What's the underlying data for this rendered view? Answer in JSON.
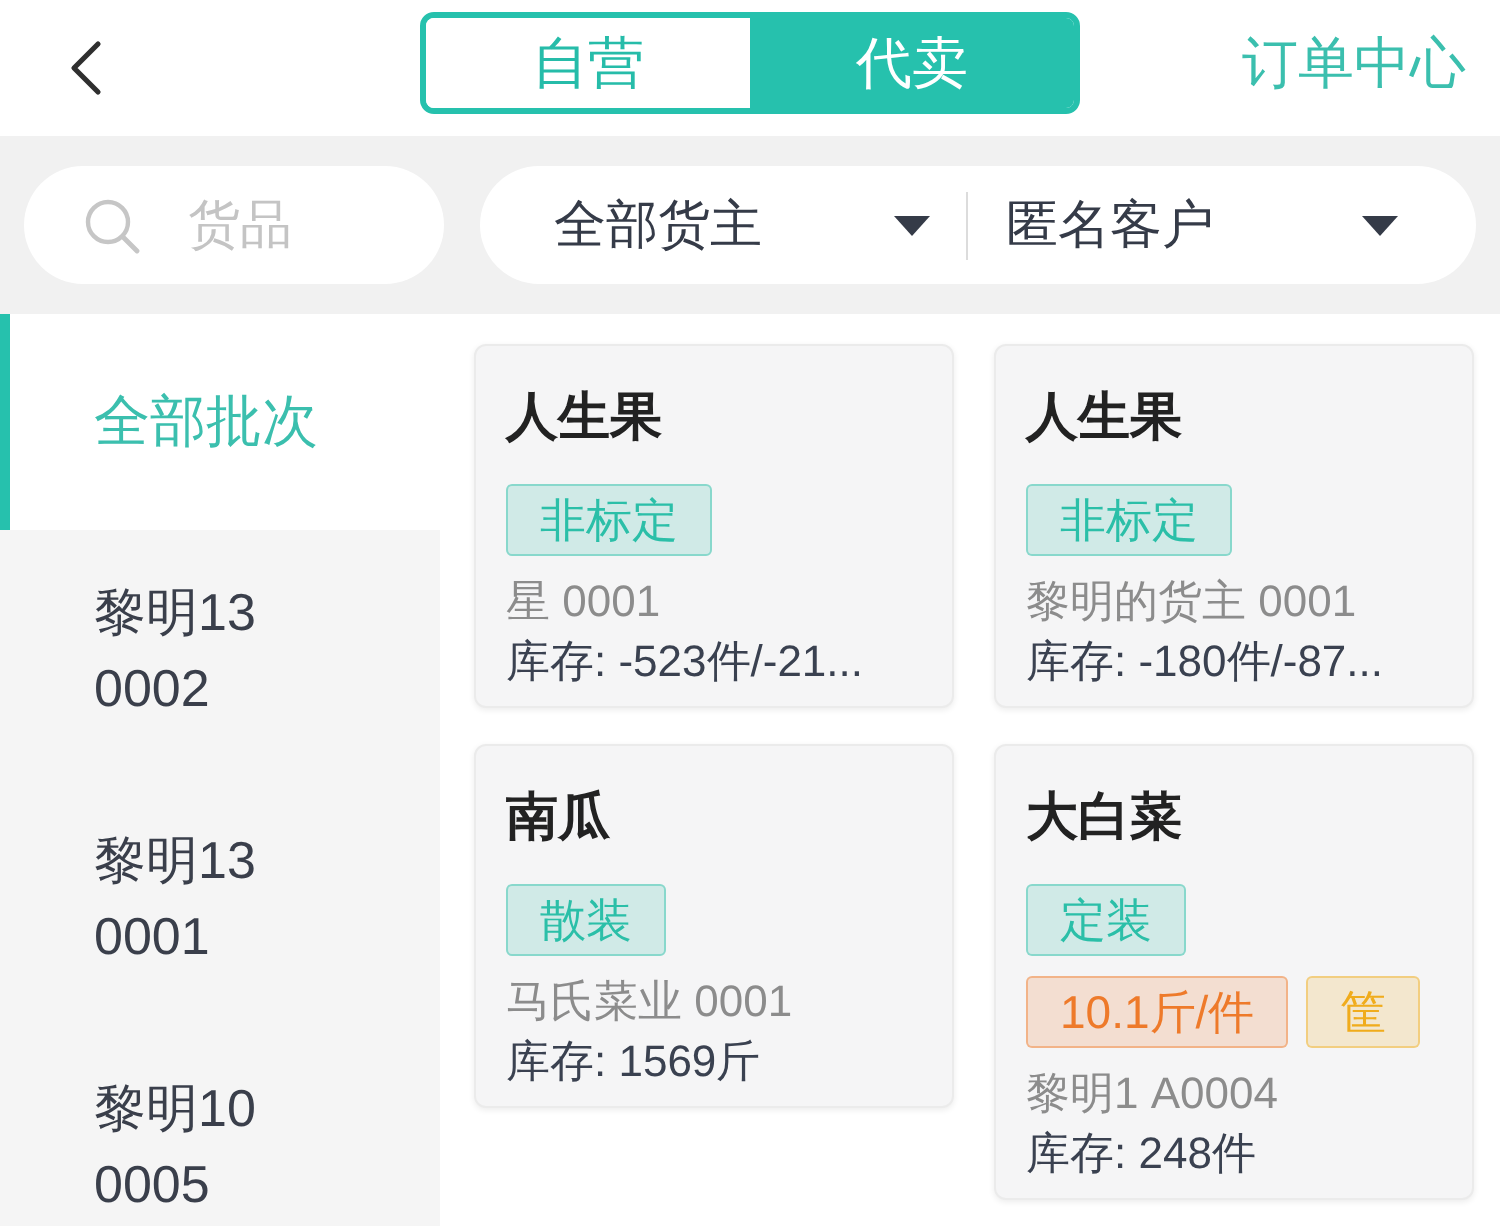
{
  "header": {
    "tabs": [
      {
        "label": "自营",
        "selected": false
      },
      {
        "label": "代卖",
        "selected": true
      }
    ],
    "action": "订单中心"
  },
  "filters": {
    "search": {
      "placeholder": "货品"
    },
    "dropdowns": [
      {
        "value": "全部货主"
      },
      {
        "value": "匿名客户"
      }
    ]
  },
  "sidebar": {
    "items": [
      {
        "label": "全部批次",
        "selected": true
      },
      {
        "label": "黎明130002",
        "selected": false
      },
      {
        "label": "黎明130001",
        "selected": false
      },
      {
        "label": "黎明100005",
        "selected": false
      }
    ]
  },
  "cards": [
    {
      "title": "人生果",
      "tag_rows": [
        {
          "tags": [
            {
              "label": "非标定",
              "color": "#2bbfa8"
            }
          ]
        }
      ],
      "owner": "星 0001",
      "stock": "库存: -523件/-21..."
    },
    {
      "title": "人生果",
      "tag_rows": [
        {
          "tags": [
            {
              "label": "非标定",
              "color": "#2bbfa8"
            }
          ]
        }
      ],
      "owner": "黎明的货主 0001",
      "stock": "库存: -180件/-87..."
    },
    {
      "title": "南瓜",
      "tag_rows": [
        {
          "tags": [
            {
              "label": "散装",
              "color": "#2bbfa8"
            }
          ]
        }
      ],
      "owner": "马氏菜业 0001",
      "stock": "库存: 1569斤"
    },
    {
      "title": "大白菜",
      "tag_rows": [
        {
          "tags": [
            {
              "label": "定装",
              "color": "#2bbfa8"
            }
          ]
        },
        {
          "tags": [
            {
              "label": "10.1斤/件",
              "color": "#ee7a2a"
            },
            {
              "label": "筐",
              "color": "#f0ac1c"
            }
          ]
        }
      ],
      "owner": "黎明1 A0004",
      "stock": "库存: 248件"
    }
  ]
}
